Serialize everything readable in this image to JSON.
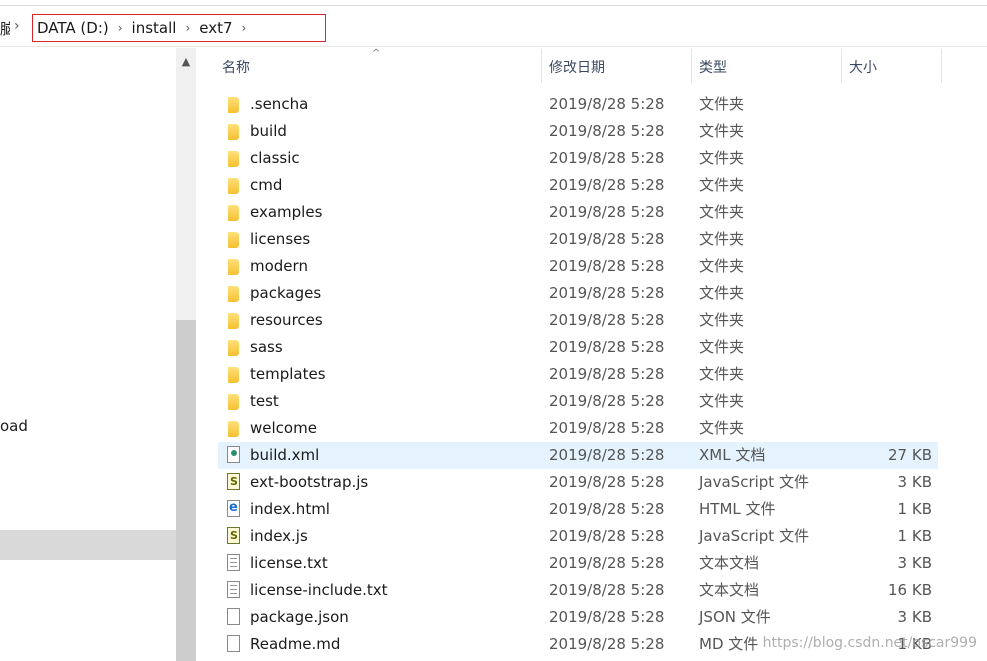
{
  "address": {
    "pc_fragment": "脑",
    "crumbs": [
      "DATA (D:)",
      "install",
      "ext7"
    ]
  },
  "left": {
    "item_partial": "oad"
  },
  "columns": {
    "name": "名称",
    "date": "修改日期",
    "type": "类型",
    "size": "大小"
  },
  "files": [
    {
      "name": ".sencha",
      "date": "2019/8/28 5:28",
      "type": "文件夹",
      "size": "",
      "icon": "folder-icon"
    },
    {
      "name": "build",
      "date": "2019/8/28 5:28",
      "type": "文件夹",
      "size": "",
      "icon": "folder-icon"
    },
    {
      "name": "classic",
      "date": "2019/8/28 5:28",
      "type": "文件夹",
      "size": "",
      "icon": "folder-icon"
    },
    {
      "name": "cmd",
      "date": "2019/8/28 5:28",
      "type": "文件夹",
      "size": "",
      "icon": "folder-icon"
    },
    {
      "name": "examples",
      "date": "2019/8/28 5:28",
      "type": "文件夹",
      "size": "",
      "icon": "folder-icon"
    },
    {
      "name": "licenses",
      "date": "2019/8/28 5:28",
      "type": "文件夹",
      "size": "",
      "icon": "folder-icon"
    },
    {
      "name": "modern",
      "date": "2019/8/28 5:28",
      "type": "文件夹",
      "size": "",
      "icon": "folder-icon"
    },
    {
      "name": "packages",
      "date": "2019/8/28 5:28",
      "type": "文件夹",
      "size": "",
      "icon": "folder-icon"
    },
    {
      "name": "resources",
      "date": "2019/8/28 5:28",
      "type": "文件夹",
      "size": "",
      "icon": "folder-icon"
    },
    {
      "name": "sass",
      "date": "2019/8/28 5:28",
      "type": "文件夹",
      "size": "",
      "icon": "folder-icon"
    },
    {
      "name": "templates",
      "date": "2019/8/28 5:28",
      "type": "文件夹",
      "size": "",
      "icon": "folder-icon"
    },
    {
      "name": "test",
      "date": "2019/8/28 5:28",
      "type": "文件夹",
      "size": "",
      "icon": "folder-icon"
    },
    {
      "name": "welcome",
      "date": "2019/8/28 5:28",
      "type": "文件夹",
      "size": "",
      "icon": "folder-icon"
    },
    {
      "name": "build.xml",
      "date": "2019/8/28 5:28",
      "type": "XML 文档",
      "size": "27 KB",
      "icon": "xml-file-icon"
    },
    {
      "name": "ext-bootstrap.js",
      "date": "2019/8/28 5:28",
      "type": "JavaScript 文件",
      "size": "3 KB",
      "icon": "js-file-icon"
    },
    {
      "name": "index.html",
      "date": "2019/8/28 5:28",
      "type": "HTML 文件",
      "size": "1 KB",
      "icon": "html-file-icon"
    },
    {
      "name": "index.js",
      "date": "2019/8/28 5:28",
      "type": "JavaScript 文件",
      "size": "1 KB",
      "icon": "js-file-icon"
    },
    {
      "name": "license.txt",
      "date": "2019/8/28 5:28",
      "type": "文本文档",
      "size": "3 KB",
      "icon": "txt-file-icon"
    },
    {
      "name": "license-include.txt",
      "date": "2019/8/28 5:28",
      "type": "文本文档",
      "size": "16 KB",
      "icon": "txt-file-icon"
    },
    {
      "name": "package.json",
      "date": "2019/8/28 5:28",
      "type": "JSON 文件",
      "size": "3 KB",
      "icon": "file-icon"
    },
    {
      "name": "Readme.md",
      "date": "2019/8/28 5:28",
      "type": "MD 文件",
      "size": "1 KB",
      "icon": "file-icon"
    }
  ],
  "selected_file": "build.xml",
  "watermark": "https://blog.csdn.net/oscar999",
  "colors": {
    "selection": "#e5f3ff",
    "highlight_box": "#d9262c",
    "header_text": "#3b4a61"
  }
}
